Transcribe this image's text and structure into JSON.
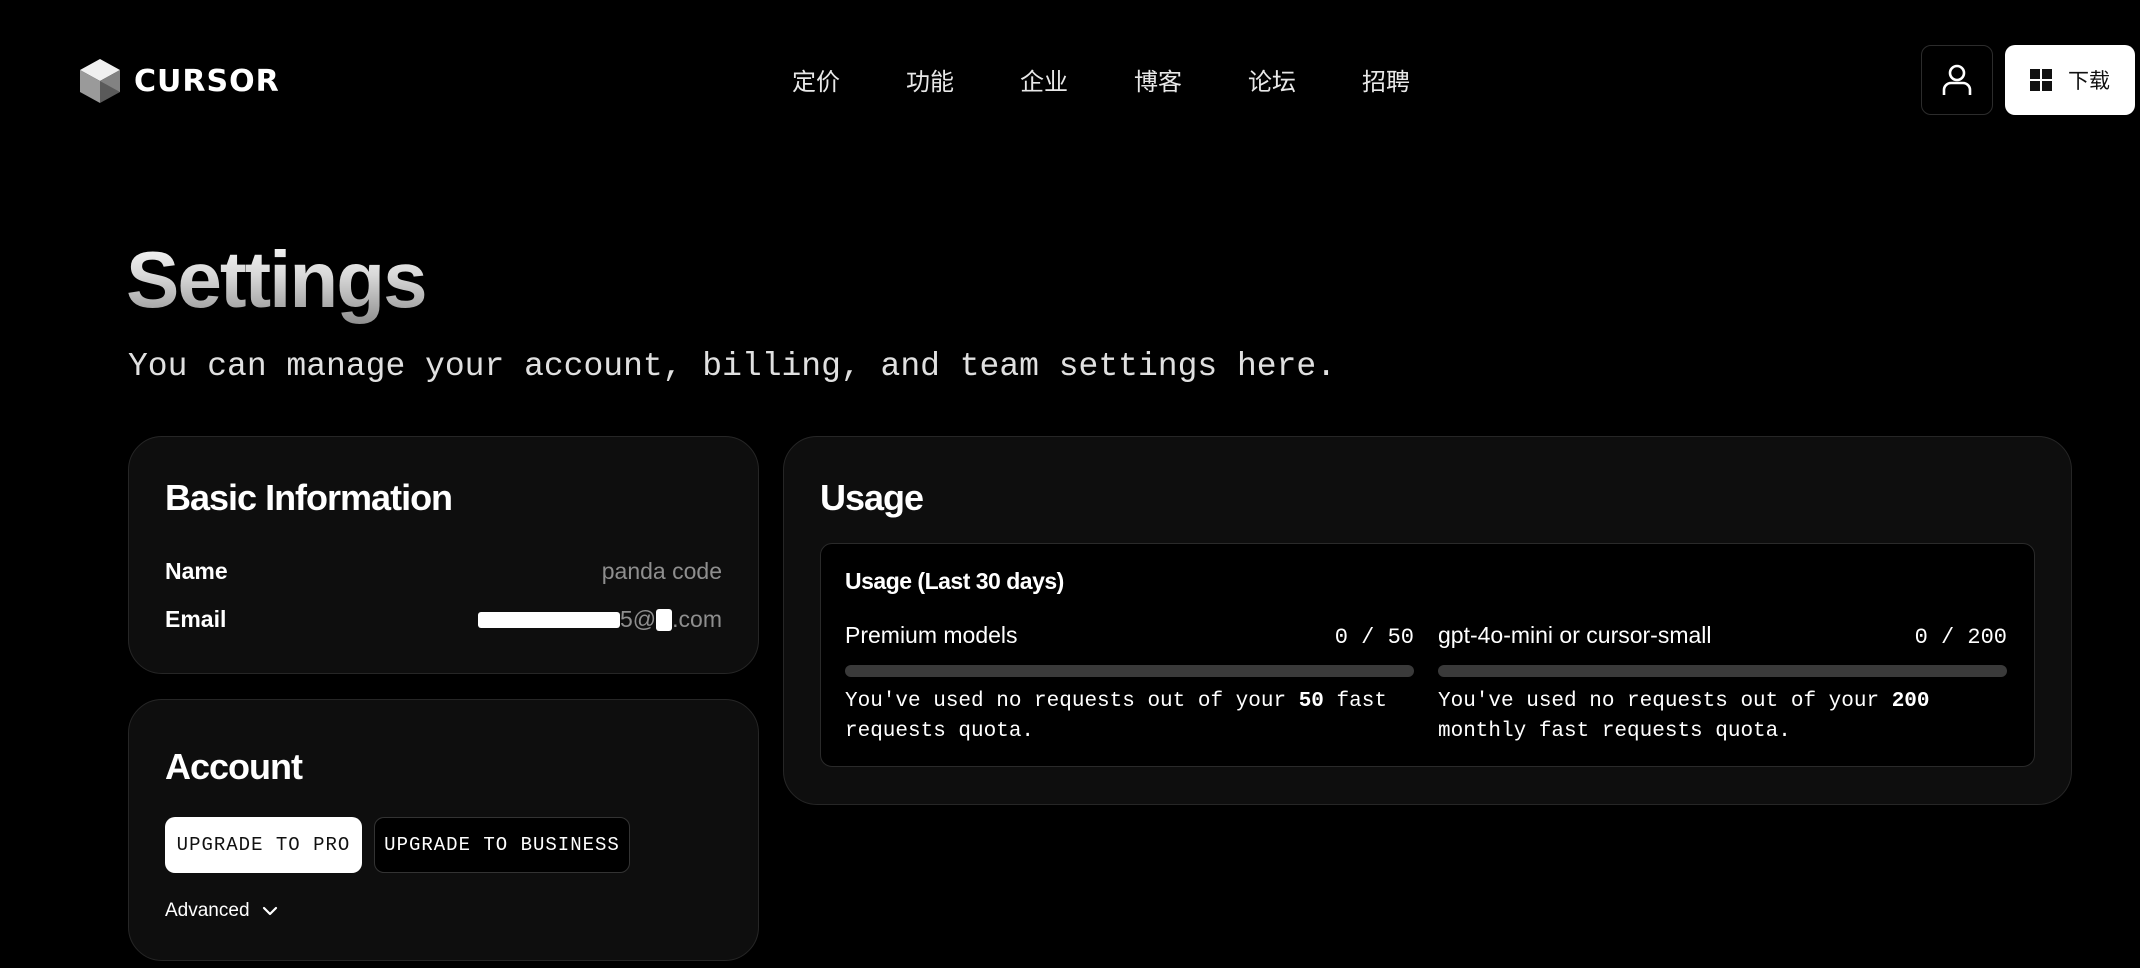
{
  "header": {
    "logo_text": "CURSOR",
    "nav": [
      "定价",
      "功能",
      "企业",
      "博客",
      "论坛",
      "招聘"
    ],
    "download_label": "下载"
  },
  "page": {
    "title": "Settings",
    "subtitle": "You can manage your account, billing, and team settings here."
  },
  "basic_info": {
    "title": "Basic Information",
    "name_label": "Name",
    "name_value": "panda code",
    "email_label": "Email",
    "email_visible_1": "5@",
    "email_visible_2": ".com"
  },
  "account": {
    "title": "Account",
    "upgrade_pro": "UPGRADE TO PRO",
    "upgrade_business": "UPGRADE TO BUSINESS",
    "advanced": "Advanced"
  },
  "usage": {
    "title": "Usage",
    "period_heading": "Usage (Last 30 days)",
    "meters": [
      {
        "label": "Premium models",
        "used": 0,
        "limit": 50,
        "count_text": "0 / 50",
        "desc_before": "You've used no requests out of your ",
        "desc_bold": "50",
        "desc_after": " fast requests quota."
      },
      {
        "label": "gpt-4o-mini or cursor-small",
        "used": 0,
        "limit": 200,
        "count_text": "0 / 200",
        "desc_before": "You've used no requests out of your ",
        "desc_bold": "200",
        "desc_after": " monthly fast requests quota."
      }
    ]
  },
  "colors": {
    "background": "#000000",
    "card": "#0e0e0e",
    "card_border": "#262626",
    "muted_text": "#8e8e8e",
    "track": "#3a3a3a"
  }
}
